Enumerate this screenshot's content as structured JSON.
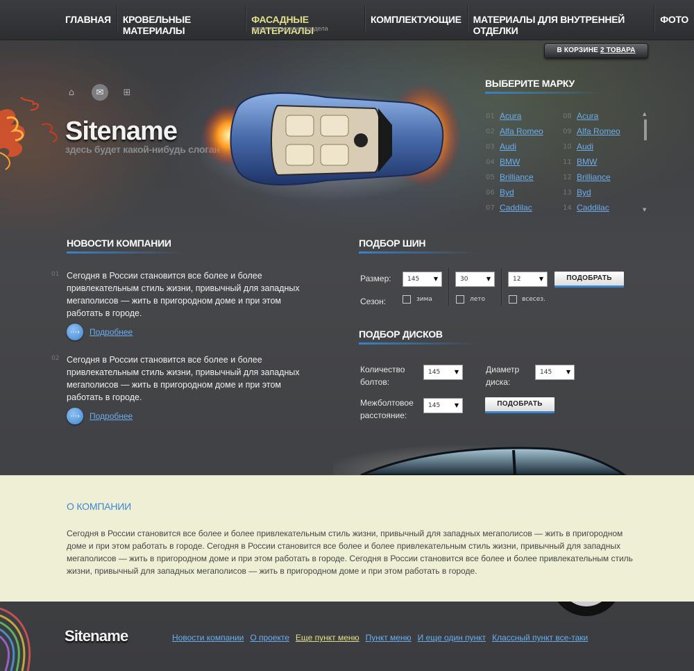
{
  "nav": {
    "items": [
      {
        "label": "ГЛАВНАЯ"
      },
      {
        "label": "КРОВЕЛЬНЫЕ МАТЕРИАЛЫ"
      },
      {
        "label": "ФАСАДНЫЕ МАТЕРИАЛЫ",
        "sub": "краткое описание раздела"
      },
      {
        "label": "КОМПЛЕКТУЮЩИЕ"
      },
      {
        "label": "МАТЕРИАЛЫ ДЛЯ ВНУТРЕННЕЙ ОТДЕЛКИ"
      },
      {
        "label": "ФОТО"
      }
    ],
    "active_index": 2
  },
  "cart": {
    "prefix": "В КОРЗИНЕ",
    "link": "2 ТОВАРА"
  },
  "header": {
    "icons": [
      "home-icon",
      "mail-icon",
      "sitemap-icon"
    ],
    "sitename": "Sitename",
    "slogan": "здесь будет какой-нибудь слоган"
  },
  "brands": {
    "title": "ВЫБЕРИТЕ МАРКУ",
    "col1": [
      {
        "num": "01",
        "name": "Acura"
      },
      {
        "num": "02",
        "name": "Alfa Romeo"
      },
      {
        "num": "03",
        "name": "Audi"
      },
      {
        "num": "04",
        "name": "BMW"
      },
      {
        "num": "05",
        "name": "Brilliance"
      },
      {
        "num": "06",
        "name": "Byd"
      },
      {
        "num": "07",
        "name": "Caddilac"
      }
    ],
    "col2": [
      {
        "num": "08",
        "name": "Acura"
      },
      {
        "num": "09",
        "name": "Alfa Romeo"
      },
      {
        "num": "10",
        "name": "Audi"
      },
      {
        "num": "11",
        "name": "BMW"
      },
      {
        "num": "12",
        "name": "Brilliance"
      },
      {
        "num": "13",
        "name": "Byd"
      },
      {
        "num": "14",
        "name": "Caddilac"
      }
    ]
  },
  "news": {
    "title": "НОВОСТИ КОМПАНИИ",
    "items": [
      {
        "num": "01",
        "text": "Сегодня в России становится все более и более привлекательным стиль жизни, привычный для западных мегаполисов — жить в пригородном доме и при этом работать в городе.",
        "more": "Подробнее"
      },
      {
        "num": "02",
        "text": "Сегодня в России становится все более и более привлекательным стиль жизни, привычный для западных мегаполисов — жить в пригородном доме и при этом работать в городе.",
        "more": "Подробнее"
      }
    ]
  },
  "tires": {
    "title": "ПОДБОР ШИН",
    "size_label": "Размер:",
    "season_label": "Сезон:",
    "width": "145",
    "profile": "30",
    "diameter": "12",
    "seasons": [
      "зима",
      "лето",
      "всесез."
    ],
    "button": "ПОДОБРАТЬ"
  },
  "disks": {
    "title": "ПОДБОР ДИСКОВ",
    "bolts_label_1": "Количество",
    "bolts_label_2": "болтов:",
    "bolts_value": "145",
    "diameter_label_1": "Диаметр",
    "diameter_label_2": "диска:",
    "diameter_value": "145",
    "spacing_label_1": "Межболтовое",
    "spacing_label_2": "расстояние:",
    "spacing_value": "145",
    "button": "ПОДОБРАТЬ"
  },
  "about": {
    "title": "О КОМПАНИИ",
    "text": "Сегодня в России становится все более и более привлекательным стиль жизни, привычный для западных мегаполисов — жить в пригородном доме и при этом работать в городе. Сегодня в России становится все более и более привлекательным стиль жизни, привычный для западных мегаполисов — жить в пригородном доме и при этом работать в городе. Сегодня в России становится все более и более привлекательным стиль жизни, привычный для западных мегаполисов — жить в пригородном доме и при этом работать в городе."
  },
  "footer": {
    "sitename": "Sitename",
    "links": [
      {
        "label": "Новости компании"
      },
      {
        "label": "О проекте"
      },
      {
        "label": "Еще пункт меню",
        "highlight": true
      },
      {
        "label": "Пункт меню"
      },
      {
        "label": "И еще один пункт"
      },
      {
        "label": "Классный пункт все-таки"
      }
    ]
  },
  "colors": {
    "accent_blue": "#3b82c8",
    "link_blue": "#6aaef0",
    "active_yellow": "#e3e089",
    "about_bg": "#efefd6"
  }
}
